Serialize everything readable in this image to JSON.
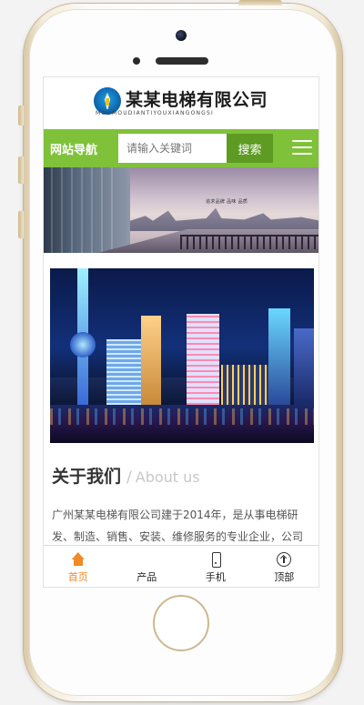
{
  "header": {
    "company_name": "某某电梯有限公司",
    "company_pinyin": "MOUMOUDIANTIYOUXIANGONGSI"
  },
  "navbar": {
    "title": "网站导航",
    "search_placeholder": "请输入关键词",
    "search_button": "搜索"
  },
  "banner": {
    "caption": "追求品牌 品味 品质"
  },
  "about": {
    "title": "关于我们",
    "separator": "/",
    "subtitle": "About us",
    "text": "广州某某电梯有限公司建于2014年，是从事电梯研发、制造、销售、安装、维修服务的专业企业，公司"
  },
  "tabbar": {
    "items": [
      {
        "label": "首页",
        "icon": "home-icon",
        "active": true
      },
      {
        "label": "产品",
        "icon": "grid-icon",
        "active": false
      },
      {
        "label": "手机",
        "icon": "phone-icon",
        "active": false
      },
      {
        "label": "顶部",
        "icon": "arrow-up-circle-icon",
        "active": false
      }
    ]
  },
  "colors": {
    "nav_green": "#7fc23a",
    "search_button_green": "#5d9b22",
    "active_tab_orange": "#f08a24"
  }
}
